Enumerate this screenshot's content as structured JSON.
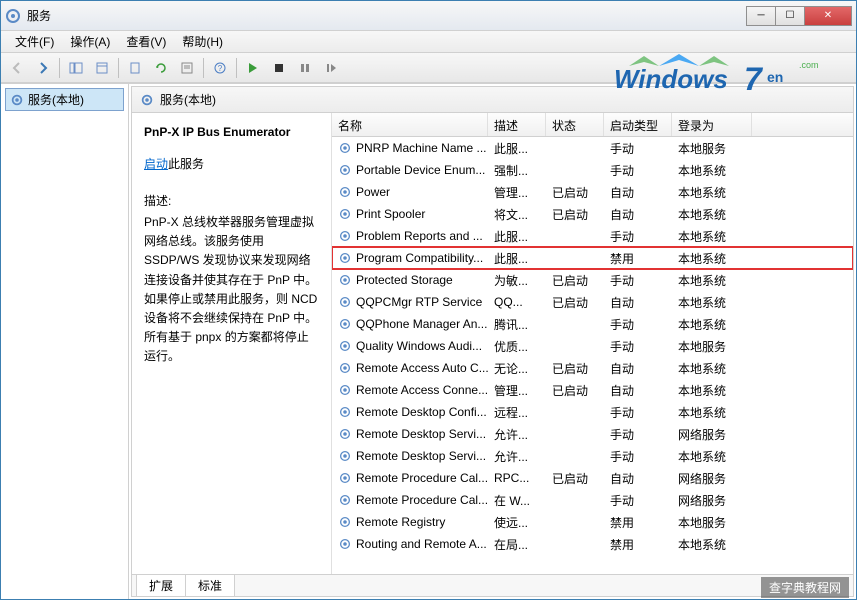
{
  "window": {
    "title": "服务"
  },
  "menus": [
    "文件(F)",
    "操作(A)",
    "查看(V)",
    "帮助(H)"
  ],
  "tree": {
    "root": "服务(本地)"
  },
  "panel_header": "服务(本地)",
  "detail": {
    "title": "PnP-X IP Bus Enumerator",
    "action_link": "启动",
    "action_text": "此服务",
    "desc_label": "描述:",
    "desc": "PnP-X 总线枚举器服务管理虚拟网络总线。该服务使用 SSDP/WS 发现协议来发现网络连接设备并使其存在于 PnP 中。如果停止或禁用此服务，则 NCD 设备将不会继续保持在 PnP 中。所有基于 pnpx 的方案都将停止运行。"
  },
  "columns": {
    "name": "名称",
    "desc": "描述",
    "status": "状态",
    "startup": "启动类型",
    "logon": "登录为"
  },
  "services": [
    {
      "name": "PNRP Machine Name ...",
      "desc": "此服...",
      "status": "",
      "startup": "手动",
      "logon": "本地服务"
    },
    {
      "name": "Portable Device Enum...",
      "desc": "强制...",
      "status": "",
      "startup": "手动",
      "logon": "本地系统"
    },
    {
      "name": "Power",
      "desc": "管理...",
      "status": "已启动",
      "startup": "自动",
      "logon": "本地系统"
    },
    {
      "name": "Print Spooler",
      "desc": "将文...",
      "status": "已启动",
      "startup": "自动",
      "logon": "本地系统"
    },
    {
      "name": "Problem Reports and ...",
      "desc": "此服...",
      "status": "",
      "startup": "手动",
      "logon": "本地系统"
    },
    {
      "name": "Program Compatibility...",
      "desc": "此服...",
      "status": "",
      "startup": "禁用",
      "logon": "本地系统",
      "hl": true
    },
    {
      "name": "Protected Storage",
      "desc": "为敏...",
      "status": "已启动",
      "startup": "手动",
      "logon": "本地系统"
    },
    {
      "name": "QQPCMgr RTP Service",
      "desc": "QQ...",
      "status": "已启动",
      "startup": "自动",
      "logon": "本地系统"
    },
    {
      "name": "QQPhone Manager An...",
      "desc": "腾讯...",
      "status": "",
      "startup": "手动",
      "logon": "本地系统"
    },
    {
      "name": "Quality Windows Audi...",
      "desc": "优质...",
      "status": "",
      "startup": "手动",
      "logon": "本地服务"
    },
    {
      "name": "Remote Access Auto C...",
      "desc": "无论...",
      "status": "已启动",
      "startup": "自动",
      "logon": "本地系统"
    },
    {
      "name": "Remote Access Conne...",
      "desc": "管理...",
      "status": "已启动",
      "startup": "自动",
      "logon": "本地系统"
    },
    {
      "name": "Remote Desktop Confi...",
      "desc": "远程...",
      "status": "",
      "startup": "手动",
      "logon": "本地系统"
    },
    {
      "name": "Remote Desktop Servi...",
      "desc": "允许...",
      "status": "",
      "startup": "手动",
      "logon": "网络服务"
    },
    {
      "name": "Remote Desktop Servi...",
      "desc": "允许...",
      "status": "",
      "startup": "手动",
      "logon": "本地系统"
    },
    {
      "name": "Remote Procedure Cal...",
      "desc": "RPC...",
      "status": "已启动",
      "startup": "自动",
      "logon": "网络服务"
    },
    {
      "name": "Remote Procedure Cal...",
      "desc": "在 W...",
      "status": "",
      "startup": "手动",
      "logon": "网络服务"
    },
    {
      "name": "Remote Registry",
      "desc": "使远...",
      "status": "",
      "startup": "禁用",
      "logon": "本地服务"
    },
    {
      "name": "Routing and Remote A...",
      "desc": "在局...",
      "status": "",
      "startup": "禁用",
      "logon": "本地系统"
    }
  ],
  "tabs": {
    "extended": "扩展",
    "standard": "标准"
  },
  "watermark": "查字典教程网"
}
